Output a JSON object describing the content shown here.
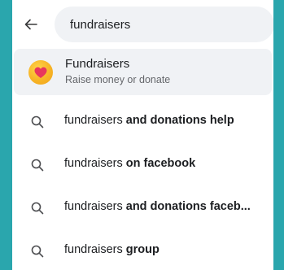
{
  "search": {
    "value": "fundraisers"
  },
  "top_result": {
    "title": "Fundraisers",
    "subtitle": "Raise money or donate",
    "icon": "heart-icon",
    "icon_bg": "#f7b426",
    "heart_color": "#e8365d"
  },
  "suggestions": [
    {
      "plain": "fundraisers",
      "bold": "and donations help"
    },
    {
      "plain": "fundraisers",
      "bold": "on facebook"
    },
    {
      "plain": "fundraisers",
      "bold": "and donations faceb..."
    },
    {
      "plain": "fundraisers",
      "bold": "group"
    }
  ],
  "colors": {
    "background": "#2aa6ad",
    "panel": "#ffffff",
    "search_bg": "#f0f2f5",
    "text": "#1c1e21",
    "secondary_text": "#65676b"
  }
}
